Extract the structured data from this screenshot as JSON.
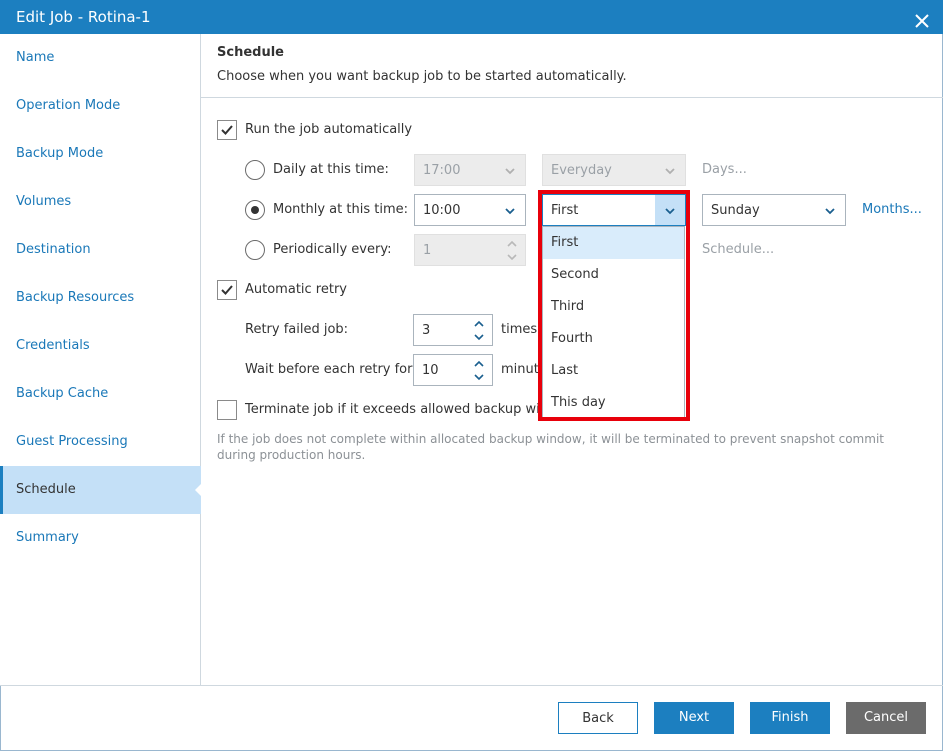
{
  "window": {
    "title": "Edit Job - Rotina-1"
  },
  "sidebar": {
    "items": [
      {
        "label": "Name"
      },
      {
        "label": "Operation Mode"
      },
      {
        "label": "Backup Mode"
      },
      {
        "label": "Volumes"
      },
      {
        "label": "Destination"
      },
      {
        "label": "Backup Resources"
      },
      {
        "label": "Credentials"
      },
      {
        "label": "Backup Cache"
      },
      {
        "label": "Guest Processing"
      },
      {
        "label": "Schedule",
        "active": true
      },
      {
        "label": "Summary"
      }
    ]
  },
  "header": {
    "title": "Schedule",
    "subtitle": "Choose when you want backup job to be started automatically."
  },
  "run_automatically": {
    "label": "Run the job automatically",
    "checked": true
  },
  "daily": {
    "label": "Daily at this time:",
    "time": "17:00",
    "days_value": "Everyday",
    "link": "Days..."
  },
  "monthly": {
    "label": "Monthly at this time:",
    "time": "10:00",
    "week_value": "First",
    "day_value": "Sunday",
    "link": "Months..."
  },
  "periodic": {
    "label": "Periodically every:",
    "value": "1",
    "link": "Schedule..."
  },
  "week_dropdown": {
    "options": [
      "First",
      "Second",
      "Third",
      "Fourth",
      "Last",
      "This day"
    ],
    "selected": "First"
  },
  "retry": {
    "label": "Automatic retry",
    "checked": true,
    "failed_label": "Retry failed job:",
    "failed_value": "3",
    "failed_unit": "times",
    "wait_label": "Wait before each retry for:",
    "wait_value": "10",
    "wait_unit": "minut"
  },
  "terminate": {
    "label": "Terminate job if it exceeds allowed backup windo",
    "checked": false,
    "note": "If the job does not complete within allocated backup window, it will be terminated to prevent snapshot commit during production hours."
  },
  "buttons": {
    "back": "Back",
    "next": "Next",
    "finish": "Finish",
    "cancel": "Cancel"
  },
  "colors": {
    "accent": "#1c7fc0",
    "highlight": "#e8000b",
    "active_nav": "#c4e0f7"
  }
}
